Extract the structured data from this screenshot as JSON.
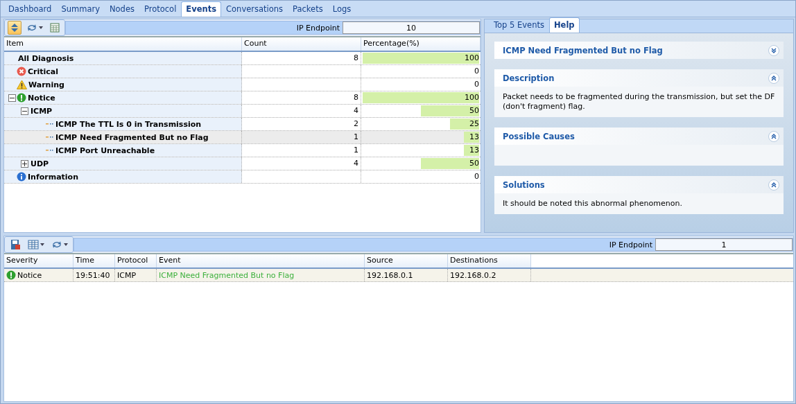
{
  "tabs": [
    {
      "label": "Dashboard",
      "selected": false
    },
    {
      "label": "Summary",
      "selected": false
    },
    {
      "label": "Nodes",
      "selected": false
    },
    {
      "label": "Protocol",
      "selected": false
    },
    {
      "label": "Events",
      "selected": true
    },
    {
      "label": "Conversations",
      "selected": false
    },
    {
      "label": "Packets",
      "selected": false
    },
    {
      "label": "Logs",
      "selected": false
    }
  ],
  "diagnosis": {
    "filter": {
      "label": "IP Endpoint",
      "value": "10"
    },
    "columns": [
      "Item",
      "Count",
      "Percentage(%)"
    ],
    "rows": [
      {
        "label": "All Diagnosis",
        "count": "8",
        "percent": "100",
        "level": 1,
        "selected": false
      },
      {
        "kind": "critical",
        "label": "Critical",
        "percent": "0",
        "selected": false
      },
      {
        "kind": "warning",
        "label": "Warning",
        "percent": "0",
        "selected": false
      },
      {
        "kind": "notice",
        "label": "Notice",
        "count": "8",
        "percent": "100",
        "level": 1,
        "selected": false,
        "expanded": true,
        "children": [
          {
            "label": "ICMP",
            "count": "4",
            "percent": "50",
            "level": 0.5,
            "selected": false,
            "expanded": true,
            "children": [
              {
                "kind": "event",
                "label": "ICMP The TTL Is 0 in Transmission",
                "count": "2",
                "percent": "25",
                "level": 0.25,
                "selected": false
              },
              {
                "kind": "event",
                "label": "ICMP Need Fragmented But no Flag",
                "count": "1",
                "percent": "13",
                "level": 0.13,
                "selected": true
              },
              {
                "kind": "event",
                "label": "ICMP Port Unreachable",
                "count": "1",
                "percent": "13",
                "level": 0.13,
                "selected": false
              }
            ]
          },
          {
            "label": "UDP",
            "count": "4",
            "percent": "50",
            "level": 0.5,
            "selected": false,
            "expanded": false
          }
        ]
      },
      {
        "kind": "information",
        "label": "Information",
        "percent": "0",
        "selected": false
      }
    ]
  },
  "side_tabs": [
    {
      "label": "Top 5 Events",
      "selected": false
    },
    {
      "label": "Help",
      "selected": true
    }
  ],
  "help_sections": [
    {
      "title": "ICMP Need Fragmented But no Flag",
      "expanded": false
    },
    {
      "title": "Description",
      "expanded": true,
      "body": "Packet needs to be fragmented during the transmission, but set the DF (don't fragment) flag."
    },
    {
      "title": "Possible Causes",
      "expanded": true
    },
    {
      "title": "Solutions",
      "expanded": true,
      "body": "It should be noted this abnormal phenomenon."
    }
  ],
  "events": {
    "filter": {
      "label": "IP Endpoint",
      "value": "1"
    },
    "columns": [
      "Severity",
      "Time",
      "Protocol",
      "Event",
      "Source",
      "Destinations"
    ],
    "rows": [
      {
        "severity": "Notice",
        "kind": "notice",
        "time": "19:51:40",
        "protocol": "ICMP",
        "event": "ICMP Need Fragmented But no Flag",
        "source": "192.168.0.1",
        "destination": "192.168.0.2",
        "selected": true
      }
    ]
  }
}
